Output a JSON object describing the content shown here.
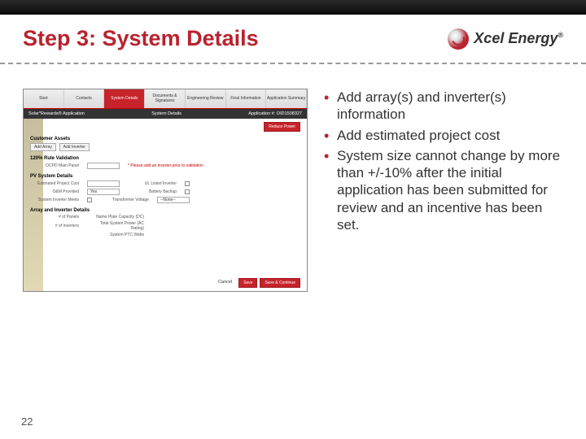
{
  "title": "Step 3: System Details",
  "logo_text": "Xcel Energy",
  "page_number": "22",
  "bullets": [
    "Add array(s) and inverter(s) information",
    "Add estimated project cost",
    "System size cannot change by more than +/-10% after the initial application has been submitted for review and an incentive has been set."
  ],
  "mini": {
    "tabs": [
      "Start",
      "Contacts",
      "System Details",
      "Documents & Signatures",
      "Engineering Review",
      "Final Information",
      "Application Summary"
    ],
    "breadcrumb_left": "Solar*Rewards® Application",
    "breadcrumb_mid": "System Details",
    "breadcrumb_right": "Application #: OID1508327",
    "reduce_btn": "Reduce Power",
    "sec1": "Customer Assets",
    "add_array": "Add Array",
    "add_inverter": "Add Inverter",
    "sec2": "120% Rule Validation",
    "ocpd_label": "OCPD Main Panel",
    "ocpd_note": "* Please add an inverter prior to validation",
    "sec3": "PV System Details",
    "row1a": "Estimated Project Cost",
    "row1b": "UL Listed Inverter",
    "row2a": "O&M Provided",
    "row2a_val": "Yes",
    "row2b": "Battery Backup",
    "row3a": "System Inverter Meets",
    "row3b": "Transformer Voltage",
    "row3b_val": "--None--",
    "sec4": "Array and Inverter Details",
    "d1": "# of Panels",
    "d1b": "Name Plate Capacity (DC)",
    "d2": "# of Inverters",
    "d2b": "Total System Power (AC Rating)",
    "d3": "System PTC Watts",
    "cancel": "Cancel",
    "save": "Save",
    "save_continue": "Save & Continue"
  }
}
